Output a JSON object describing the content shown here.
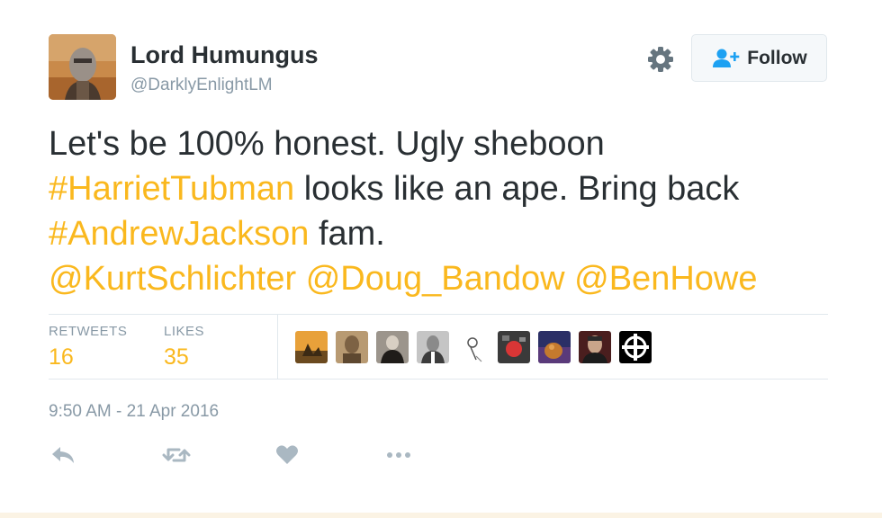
{
  "header": {
    "display_name": "Lord Humungus",
    "handle": "@DarklyEnlightLM",
    "follow_label": "Follow"
  },
  "tweet": {
    "line1": "Let's be 100% honest. Ugly sheboon",
    "hashtag1": "#HarrietTubman",
    "line2_rest": " looks like an ape. Bring back",
    "hashtag2": "#AndrewJackson",
    "line3_rest": " fam.",
    "mention1": "@KurtSchlichter",
    "mention2": "@Doug_Bandow",
    "mention3": "@BenHowe"
  },
  "stats": {
    "retweets_label": "RETWEETS",
    "retweets_count": "16",
    "likes_label": "LIKES",
    "likes_count": "35"
  },
  "timestamp": "9:50 AM - 21 Apr 2016",
  "colors": {
    "link": "#fab81e",
    "text": "#292f33",
    "muted": "#8899a6",
    "border": "#e1e8ed"
  },
  "icons": [
    "settings-gear-icon",
    "follow-person-plus-icon",
    "reply-icon",
    "retweet-icon",
    "like-heart-icon",
    "more-dots-icon"
  ]
}
